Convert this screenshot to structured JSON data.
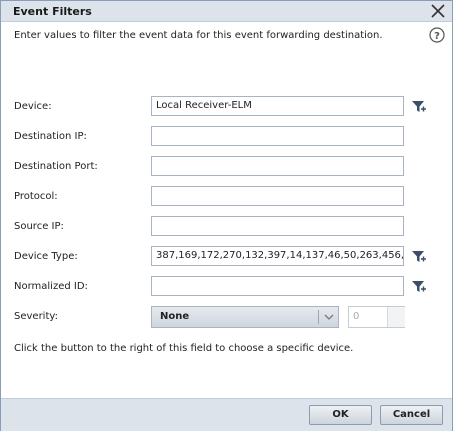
{
  "dialog": {
    "title": "Event Filters",
    "intro": "Enter values to filter the event data for this event forwarding destination.",
    "hint": "Click the button to the right of this field to choose a specific device."
  },
  "fields": {
    "device": {
      "label": "Device:",
      "value": "Local Receiver-ELM"
    },
    "destination_ip": {
      "label": "Destination IP:",
      "value": ""
    },
    "destination_port": {
      "label": "Destination Port:",
      "value": ""
    },
    "protocol": {
      "label": "Protocol:",
      "value": ""
    },
    "source_ip": {
      "label": "Source IP:",
      "value": ""
    },
    "device_type": {
      "label": "Device Type:",
      "value": "387,169,172,270,132,397,14,137,46,50,263,456,"
    },
    "normalized_id": {
      "label": "Normalized ID:",
      "value": ""
    },
    "severity": {
      "label": "Severity:",
      "selected": "None",
      "spinner_value": "0"
    }
  },
  "buttons": {
    "ok": "OK",
    "cancel": "Cancel"
  },
  "icons": {
    "close": "close-icon",
    "help": "help-icon",
    "filter": "filter-icon"
  },
  "colors": {
    "titlebar": "#dde3ea",
    "border": "#8a9db5",
    "filter_icon": "#3b4f66"
  }
}
